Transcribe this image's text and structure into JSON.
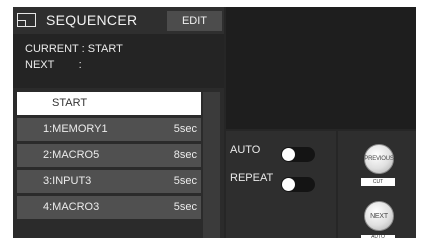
{
  "sequencer": {
    "title": "SEQUENCER",
    "edit_label": "EDIT",
    "current_line": "CURRENT : START",
    "next_line": "NEXT        :",
    "items": [
      {
        "name": "START",
        "duration": ""
      },
      {
        "name": "1:MEMORY1",
        "duration": "5sec"
      },
      {
        "name": "2:MACRO5",
        "duration": "8sec"
      },
      {
        "name": "3:INPUT3",
        "duration": "5sec"
      },
      {
        "name": "4:MACRO3",
        "duration": "5sec"
      }
    ]
  },
  "controls": {
    "auto_label": "AUTO",
    "auto_on": false,
    "repeat_label": "REPEAT",
    "repeat_on": false
  },
  "buttons": {
    "previous_label": "PREVIOUS",
    "cut_caption": "CUT",
    "next_label": "NEXT",
    "auto_caption": "AUTO"
  },
  "colors": {
    "background": "#262626",
    "row": "#505050",
    "row_active": "#ffffff",
    "toggle_track": "#141414"
  },
  "icons": {
    "sequencer": "sequencer-icon"
  }
}
